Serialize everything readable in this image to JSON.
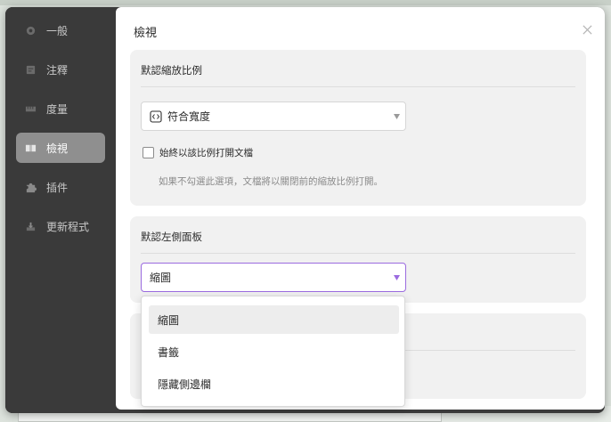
{
  "colors": {
    "sidebar_bg": "#3a3a3a",
    "sidebar_active": "#8f8f8f",
    "accent": "#9b6be0",
    "card_bg": "#f1f1f1"
  },
  "sidebar": {
    "items": [
      {
        "label": "一般",
        "icon": "circle-icon"
      },
      {
        "label": "注釋",
        "icon": "note-icon"
      },
      {
        "label": "度量",
        "icon": "ruler-icon"
      },
      {
        "label": "檢視",
        "icon": "book-icon",
        "active": true
      },
      {
        "label": "插件",
        "icon": "puzzle-icon"
      },
      {
        "label": "更新程式",
        "icon": "download-icon"
      }
    ]
  },
  "content": {
    "title": "檢視",
    "zoom_section": {
      "title": "默認縮放比例",
      "select_value": "符合寬度",
      "checkbox_label": "始終以該比例打開文檔",
      "checkbox_checked": false,
      "help_text": "如果不勾選此選項，文檔將以關閉前的縮放比例打開。"
    },
    "left_panel_section": {
      "title": "默認左側面板",
      "select_value": "縮圖"
    },
    "dropdown": {
      "options": [
        "縮圖",
        "書籤",
        "隱藏側邊欄"
      ],
      "highlighted_index": 0
    }
  }
}
